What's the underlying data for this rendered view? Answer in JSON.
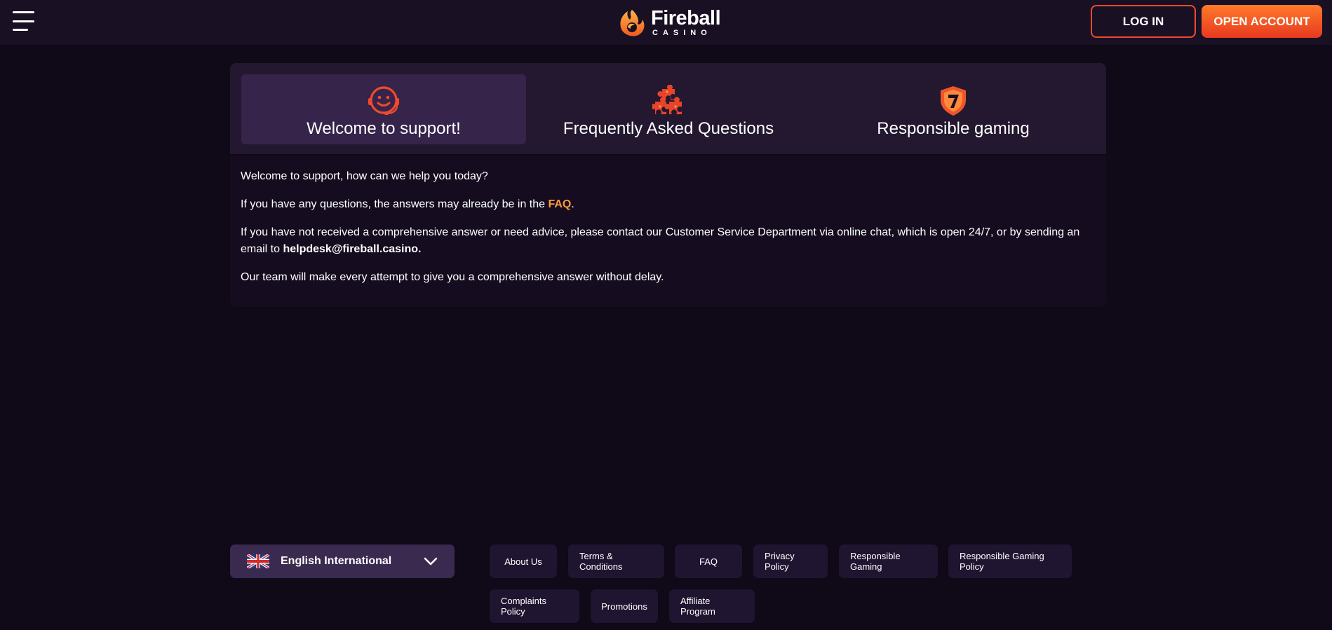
{
  "header": {
    "logo_name": "Fireball",
    "logo_sub": "CASINO",
    "login_label": "LOG IN",
    "open_account_label": "OPEN ACCOUNT"
  },
  "tabs": [
    {
      "label": "Welcome to support!",
      "icon": "headset-smile-icon",
      "active": true
    },
    {
      "label": "Frequently Asked Questions",
      "icon": "puzzle-pieces-icon",
      "active": false
    },
    {
      "label": "Responsible gaming",
      "icon": "shield-seven-icon",
      "active": false
    }
  ],
  "content": {
    "p1": "Welcome to support, how can we help you today?",
    "p2_before": "If you have any questions, the answers may already be in the ",
    "p2_link": "FAQ",
    "p2_after": ".",
    "p3_before": "If you have not received a comprehensive answer or need advice, please contact our Customer Service Department via online chat, which is open 24/7, or by sending an email to ",
    "p3_email": "helpdesk@fireball.casino.",
    "p4": "Our team will make every attempt to give you a comprehensive answer without delay."
  },
  "language": {
    "selected": "English International",
    "flag_icon": "uk-flag-icon"
  },
  "footer": {
    "links": [
      "About Us",
      "Terms & Conditions",
      "FAQ",
      "Privacy Policy",
      "Responsible Gaming",
      "Responsible Gaming Policy",
      "Complaints Policy",
      "Promotions",
      "Affiliate Program"
    ]
  },
  "colors": {
    "accent_orange": "#ff9a3c",
    "accent_red": "#ef4a2c",
    "background": "#0f0918"
  }
}
